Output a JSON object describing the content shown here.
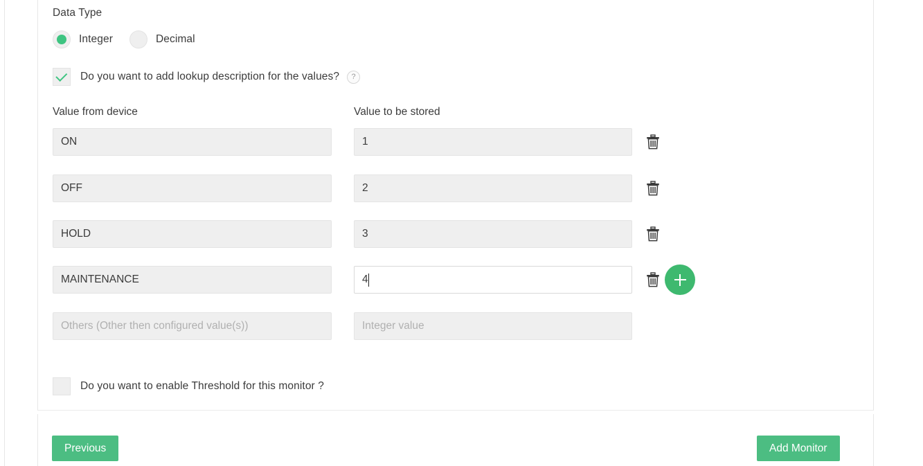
{
  "form": {
    "data_type": {
      "label": "Data Type",
      "options": [
        {
          "label": "Integer",
          "selected": true
        },
        {
          "label": "Decimal",
          "selected": false
        }
      ]
    },
    "lookup_toggle": {
      "label": "Do you want to add lookup description for the values?",
      "checked": true,
      "help_icon": "question-mark-icon",
      "help_glyph": "?"
    },
    "columns": {
      "device_value": "Value from device",
      "stored_value": "Value to be stored"
    },
    "rows": [
      {
        "device_value": "ON",
        "stored_value": "1",
        "deletable": true,
        "focused": false
      },
      {
        "device_value": "OFF",
        "stored_value": "2",
        "deletable": true,
        "focused": false
      },
      {
        "device_value": "HOLD",
        "stored_value": "3",
        "deletable": true,
        "focused": false
      },
      {
        "device_value": "MAINTENANCE",
        "stored_value": "4",
        "deletable": true,
        "focused": true
      }
    ],
    "others_row": {
      "device_placeholder": "Others (Other then configured value(s))",
      "stored_placeholder": "Integer value",
      "device_value": "",
      "stored_value": ""
    },
    "add_row_button": {
      "icon": "plus-icon",
      "title": "Add row"
    },
    "delete_icon": {
      "icon": "trash-icon",
      "title": "Delete row"
    },
    "threshold_toggle": {
      "label": "Do you want to enable Threshold for this monitor ?",
      "checked": false
    }
  },
  "footer": {
    "previous_label": "Previous",
    "submit_label": "Add Monitor"
  },
  "colors": {
    "accent_green": "#4cbd82",
    "plus_green": "#3eb96f",
    "radio_green": "#3ec481",
    "input_bg": "#efefef",
    "border": "#e7e7e7",
    "text": "#3b3b3b",
    "placeholder": "#b0b0b0"
  }
}
